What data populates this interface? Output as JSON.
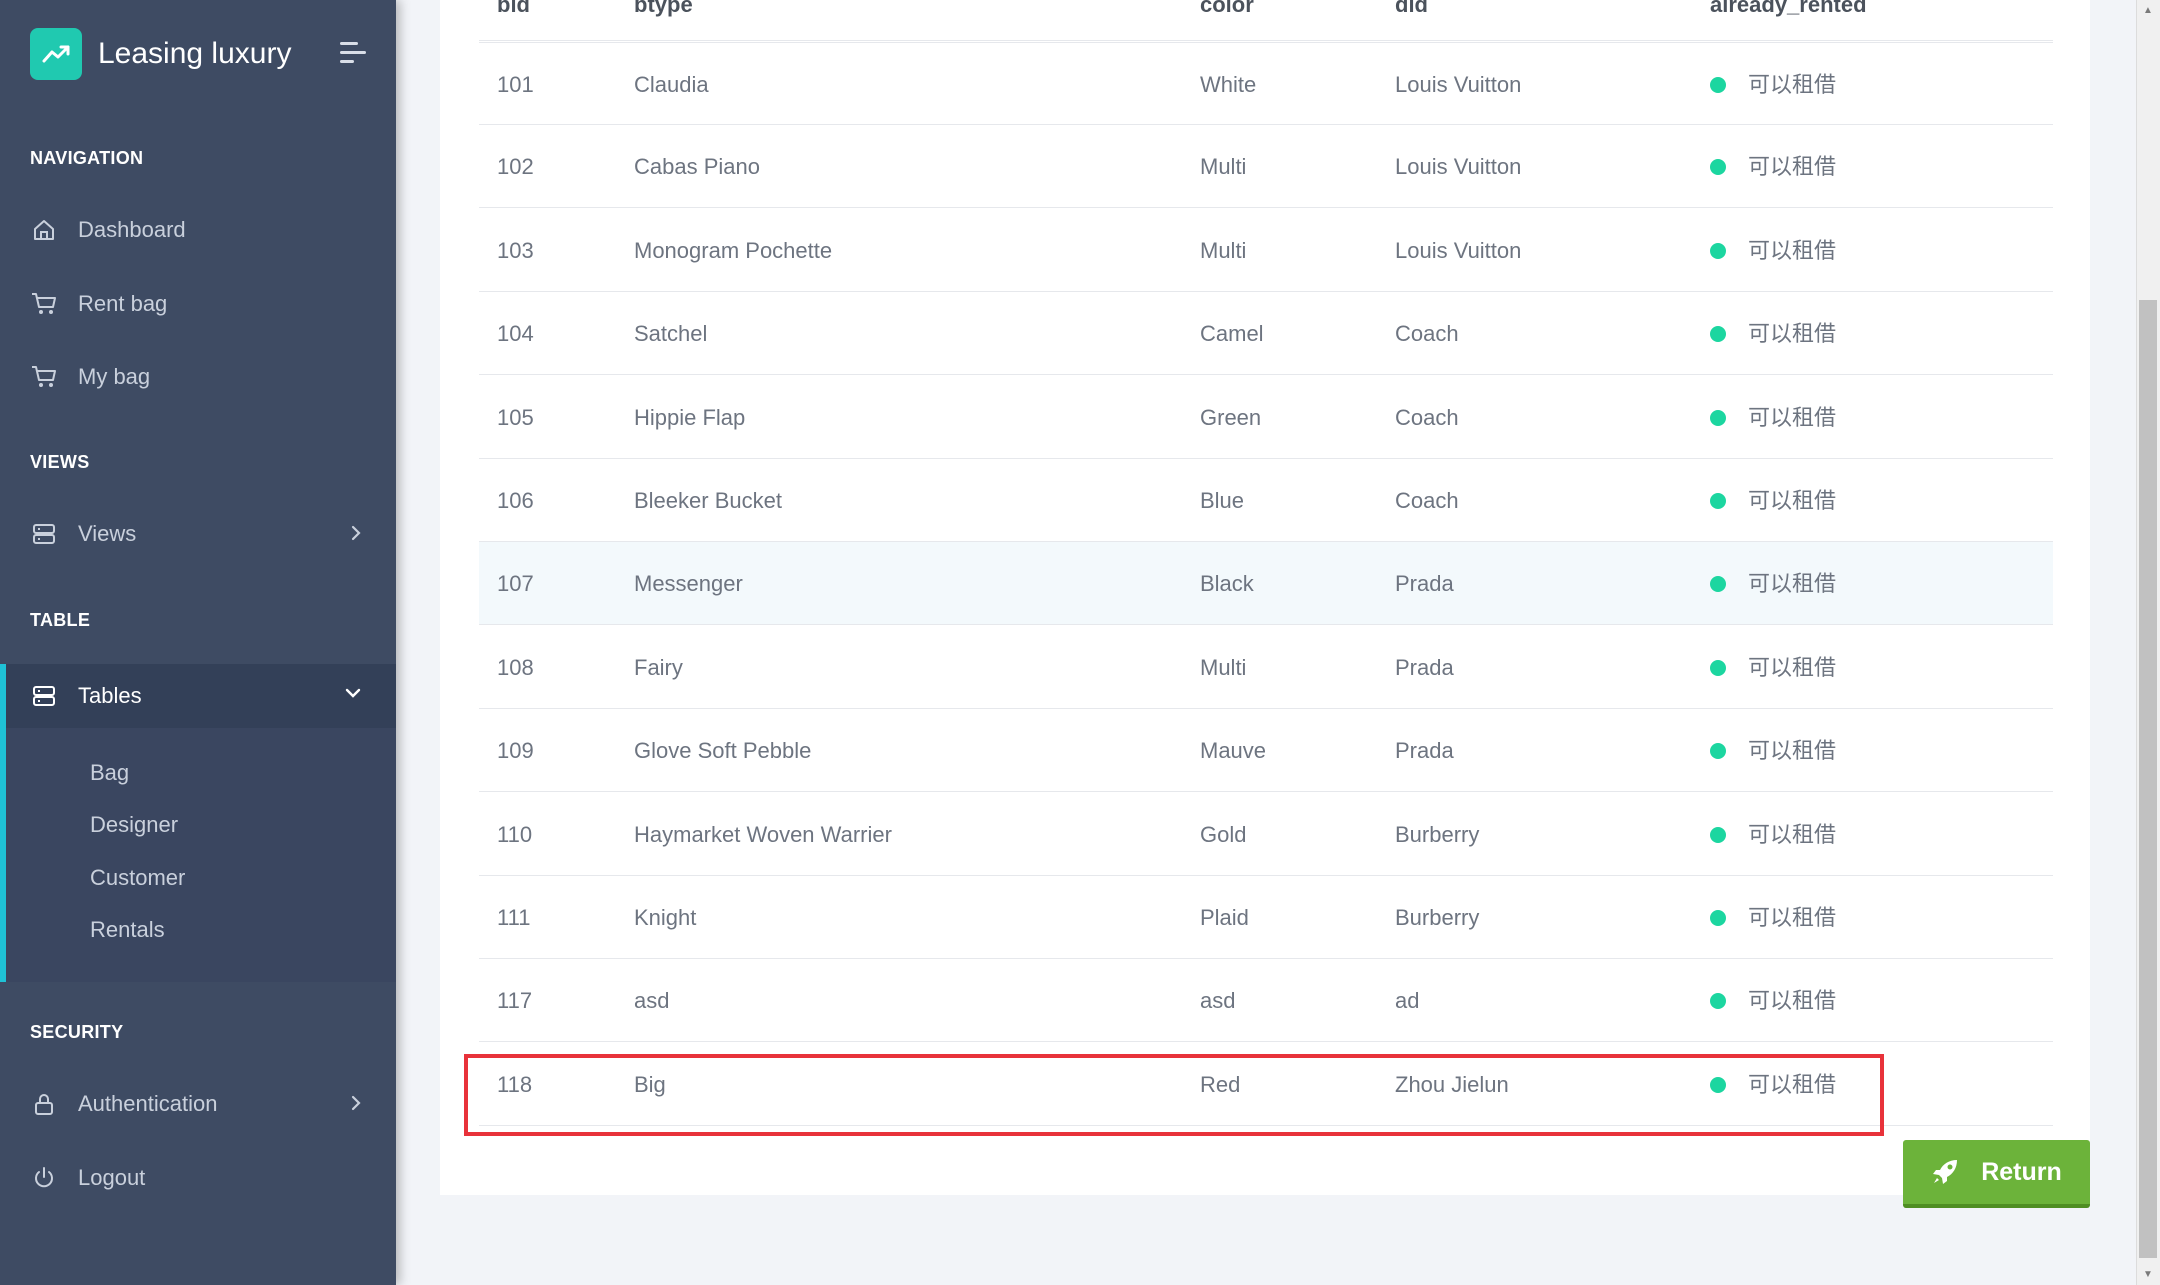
{
  "brand": {
    "title": "Leasing luxury"
  },
  "sidebar": {
    "sections": {
      "navigation": "NAVIGATION",
      "views": "VIEWS",
      "table": "TABLE",
      "security": "SECURITY"
    },
    "items": {
      "dashboard": "Dashboard",
      "rent_bag": "Rent bag",
      "my_bag": "My bag",
      "views": "Views",
      "tables": "Tables",
      "authentication": "Authentication",
      "logout": "Logout"
    },
    "tables_submenu": [
      "Bag",
      "Designer",
      "Customer",
      "Rentals"
    ]
  },
  "table": {
    "headers": {
      "bid": "bid",
      "btype": "btype",
      "color": "color",
      "did": "did",
      "already_rented": "already_rented"
    },
    "rows": [
      {
        "bid": "101",
        "btype": "Claudia",
        "color": "White",
        "did": "Louis Vuitton",
        "status": "可以租借"
      },
      {
        "bid": "102",
        "btype": "Cabas Piano",
        "color": "Multi",
        "did": "Louis Vuitton",
        "status": "可以租借"
      },
      {
        "bid": "103",
        "btype": "Monogram Pochette",
        "color": "Multi",
        "did": "Louis Vuitton",
        "status": "可以租借"
      },
      {
        "bid": "104",
        "btype": "Satchel",
        "color": "Camel",
        "did": "Coach",
        "status": "可以租借"
      },
      {
        "bid": "105",
        "btype": "Hippie Flap",
        "color": "Green",
        "did": "Coach",
        "status": "可以租借"
      },
      {
        "bid": "106",
        "btype": "Bleeker Bucket",
        "color": "Blue",
        "did": "Coach",
        "status": "可以租借"
      },
      {
        "bid": "107",
        "btype": "Messenger",
        "color": "Black",
        "did": "Prada",
        "status": "可以租借"
      },
      {
        "bid": "108",
        "btype": "Fairy",
        "color": "Multi",
        "did": "Prada",
        "status": "可以租借"
      },
      {
        "bid": "109",
        "btype": "Glove Soft Pebble",
        "color": "Mauve",
        "did": "Prada",
        "status": "可以租借"
      },
      {
        "bid": "110",
        "btype": "Haymarket Woven Warrier",
        "color": "Gold",
        "did": "Burberry",
        "status": "可以租借"
      },
      {
        "bid": "111",
        "btype": "Knight",
        "color": "Plaid",
        "did": "Burberry",
        "status": "可以租借"
      },
      {
        "bid": "117",
        "btype": "asd",
        "color": "asd",
        "did": "ad",
        "status": "可以租借"
      },
      {
        "bid": "118",
        "btype": "Big",
        "color": "Red",
        "did": "Zhou Jielun",
        "status": "可以租借"
      }
    ]
  },
  "actions": {
    "return_label": "Return"
  },
  "colors": {
    "accent": "#1fc2d6",
    "brand": "#20c9b0",
    "status_available": "#1cd6a0",
    "return_button": "#6cb33a",
    "highlight": "#e8323a"
  }
}
